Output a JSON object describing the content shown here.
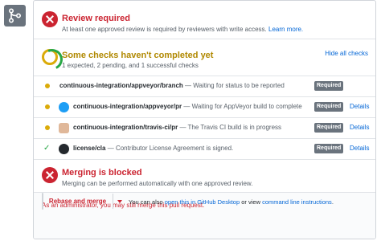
{
  "colors": {
    "danger": "#cb2431",
    "warning": "#dbab09",
    "success": "#28a745",
    "link": "#0366d6",
    "muted": "#6a737d"
  },
  "icons": {
    "merge": "git-merge-icon",
    "review": "x-circle-icon",
    "checks": "pending-ring-icon",
    "merging": "x-circle-icon"
  },
  "review": {
    "title": "Review required",
    "subtitle": "At least one approved review is required by reviewers with write access.",
    "learn_more": "Learn more."
  },
  "checks_summary": {
    "title": "Some checks haven't completed yet",
    "subtitle": "1 expected, 2 pending, and 1 successful checks",
    "hide_link": "Hide all checks"
  },
  "checks": [
    {
      "status": "pending",
      "name": "continuous-integration/appveyor/branch",
      "separator": " — ",
      "description": "Waiting for status to be reported",
      "badge": "Required",
      "details": ""
    },
    {
      "status": "pending",
      "name": "continuous-integration/appveyor/pr",
      "separator": " — ",
      "description": "Waiting for AppVeyor build to complete",
      "badge": "Required",
      "details": "Details"
    },
    {
      "status": "pending",
      "name": "continuous-integration/travis-ci/pr",
      "separator": " — ",
      "description": "The Travis CI build is in progress",
      "badge": "Required",
      "details": "Details"
    },
    {
      "status": "success",
      "name": "license/cla",
      "separator": " — ",
      "description": "Contributor License Agreement is signed.",
      "badge": "Required",
      "details": "Details"
    }
  ],
  "merge": {
    "title": "Merging is blocked",
    "subtitle": "Merging can be performed automatically with one approved review."
  },
  "admin": {
    "message": "As an administrator, you may still merge this pull request.",
    "button": "Rebase and merge",
    "also_prefix": "You can also ",
    "desktop_link": "open this in GitHub Desktop",
    "or_text": " or view ",
    "cli_link": "command line instructions",
    "period": "."
  }
}
